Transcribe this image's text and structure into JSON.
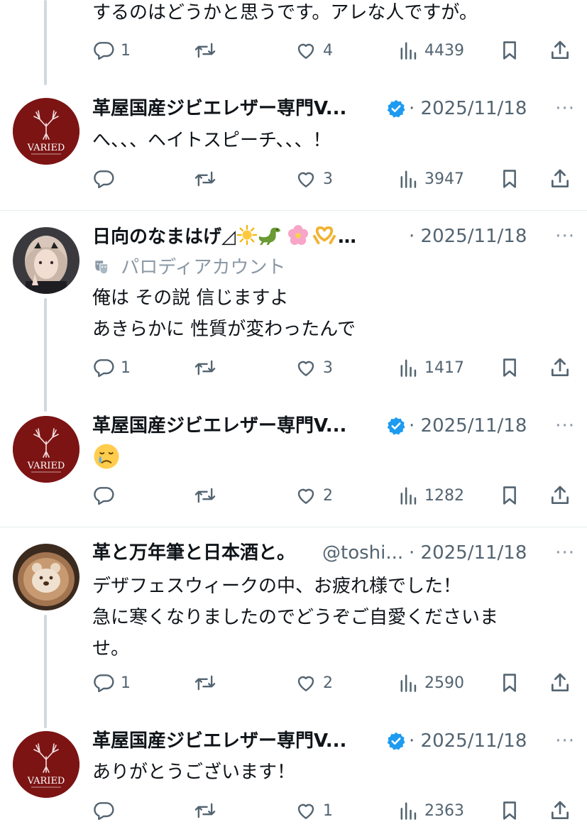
{
  "tweets": [
    {
      "text": "するのはどうかと思うです。アレな人ですが。",
      "replies": "1",
      "retweets": "",
      "likes": "4",
      "views": "4439"
    },
    {
      "name": "革屋国産ジビエレザー専門V...",
      "verified": true,
      "date": "· 2025/11/18",
      "avatar_text": "VARIED",
      "text": "へ、、、ヘイトスピーチ、、、！",
      "replies": "",
      "retweets": "",
      "likes": "3",
      "views": "3947"
    },
    {
      "name": "日向のなまはげ◿",
      "name_tail": "…",
      "date": "· 2025/11/18",
      "sub_label": "パロディアカウント",
      "text": "俺は その説 信じますよ\nあきらかに 性質が変わったんで",
      "replies": "1",
      "retweets": "",
      "likes": "3",
      "views": "1417"
    },
    {
      "name": "革屋国産ジビエレザー専門V...",
      "verified": true,
      "date": "· 2025/11/18",
      "avatar_text": "VARIED",
      "text": "😢",
      "replies": "",
      "retweets": "",
      "likes": "2",
      "views": "1282"
    },
    {
      "name": "革と万年筆と日本酒と。",
      "handle": "@toshi...",
      "date": "· 2025/11/18",
      "text": "デザフェスウィークの中、お疲れ様でした！\n急に寒くなりましたのでどうぞご自愛くださいま\nせ。",
      "replies": "1",
      "retweets": "",
      "likes": "2",
      "views": "2590"
    },
    {
      "name": "革屋国産ジビエレザー専門V...",
      "verified": true,
      "date": "· 2025/11/18",
      "avatar_text": "VARIED",
      "text": "ありがとうございます！",
      "replies": "",
      "retweets": "",
      "likes": "1",
      "views": "2363"
    }
  ],
  "more_label": "···",
  "colors": {
    "muted": "#536471",
    "verified": "#1d9bf0",
    "avatar_red": "#7c1414",
    "thread_line": "#cfd9de"
  }
}
